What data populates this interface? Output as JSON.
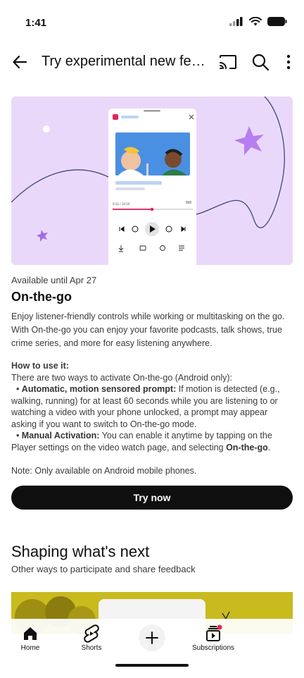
{
  "status": {
    "time": "1:41"
  },
  "header": {
    "title": "Try experimental new features",
    "icons": [
      "arrow-left-icon",
      "cast-icon",
      "search-icon",
      "more-vert-icon"
    ]
  },
  "feature": {
    "availability": "Available until Apr 27",
    "title": "On-the-go",
    "description": "Enjoy listener-friendly controls while working or multitasking on the go. With On-the-go you can enjoy your favorite podcasts, talk shows, true crime series, and more for easy listening anywhere.",
    "howto_title": "How to use it:",
    "howto_intro": "There are two ways to activate On-the-go (Android only):",
    "bullet1_label": "Automatic, motion sensored prompt:",
    "bullet1_text": " If motion is detected (e.g., walking, running) for at least 60 seconds while you are listening to or watching a video with your phone unlocked, a prompt may appear asking if you want to switch to On-the-go mode.",
    "bullet2_label": "Manual Activation:",
    "bullet2_text": " You can enable it anytime by tapping on the Player settings on the video watch page, and selecting ",
    "bullet2_end": "On-the-go",
    "note": "Note: Only available on Android mobile phones.",
    "cta": "Try now",
    "player_time": "0:32 / 14:10"
  },
  "section": {
    "title": "Shaping what's next",
    "subtitle": "Other ways to participate and share feedback"
  },
  "nav": {
    "home": "Home",
    "shorts": "Shorts",
    "subscriptions": "Subscriptions"
  },
  "colors": {
    "hero_bg": "#ead8fa",
    "accent_purple": "#b67ef0",
    "progress_red": "#e0245e",
    "button_dark": "#0f0f0f",
    "promo_yellow": "#c9ba1e"
  }
}
